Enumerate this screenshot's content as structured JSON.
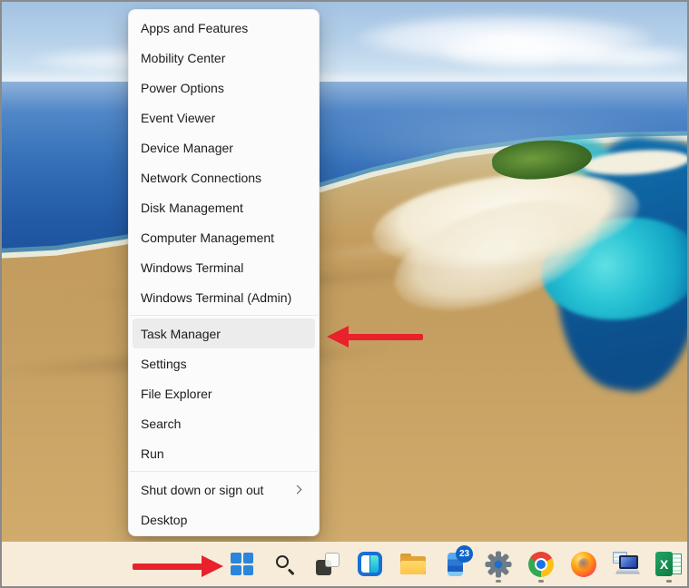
{
  "theme": {
    "accent_red": "#e8212b",
    "taskbar_bg": "#f7ecda",
    "menu_bg": "#fbfbfb",
    "menu_highlight": "#ececec",
    "start_blue": "#2b85dc"
  },
  "menu": {
    "items": [
      {
        "label": "Apps and Features"
      },
      {
        "label": "Mobility Center"
      },
      {
        "label": "Power Options"
      },
      {
        "label": "Event Viewer"
      },
      {
        "label": "Device Manager"
      },
      {
        "label": "Network Connections"
      },
      {
        "label": "Disk Management"
      },
      {
        "label": "Computer Management"
      },
      {
        "label": "Windows Terminal"
      },
      {
        "label": "Windows Terminal (Admin)"
      },
      {
        "label": "Task Manager",
        "highlighted": true
      },
      {
        "label": "Settings"
      },
      {
        "label": "File Explorer"
      },
      {
        "label": "Search"
      },
      {
        "label": "Run"
      },
      {
        "label": "Shut down or sign out",
        "has_submenu": true
      },
      {
        "label": "Desktop"
      }
    ]
  },
  "taskbar": {
    "icons": [
      "start",
      "search",
      "task-view",
      "widgets",
      "file-explorer",
      "phone-link",
      "settings",
      "chrome",
      "firefox",
      "remote-desktop",
      "excel"
    ],
    "phone_badge_count": "23",
    "excel_glyph": "X",
    "running_indicators": [
      "settings",
      "chrome",
      "excel"
    ]
  },
  "annotations": {
    "menu_arrow_target": "Task Manager",
    "taskbar_arrow_target": "Start button"
  }
}
